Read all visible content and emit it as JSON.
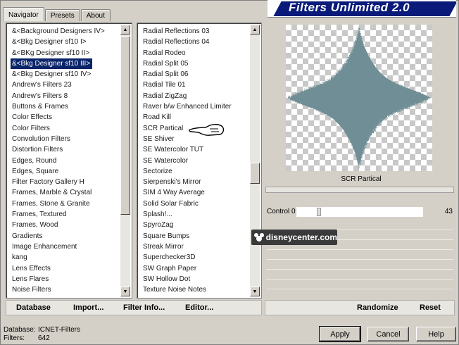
{
  "tabs": [
    "Navigator",
    "Presets",
    "About"
  ],
  "banner": {
    "title": "Filters Unlimited 2.0"
  },
  "categories": {
    "items": [
      "&<Background Designers IV>",
      "&<Bkg Designer sf10 I>",
      "&<BKg Designer sf10 II>",
      "&<Bkg Designer sf10 III>",
      "&<Bkg Designer sf10 IV>",
      "Andrew's Filters 23",
      "Andrew's Filters 8",
      "Buttons & Frames",
      "Color Effects",
      "Color Filters",
      "Convolution Filters",
      "Distortion Filters",
      "Edges, Round",
      "Edges, Square",
      "Filter Factory Gallery H",
      "Frames, Marble & Crystal",
      "Frames, Stone & Granite",
      "Frames, Textured",
      "Frames, Wood",
      "Gradients",
      "Image Enhancement",
      "kang",
      "Lens Effects",
      "Lens Flares",
      "Noise Filters"
    ],
    "selected_index": 3
  },
  "filters": {
    "items": [
      "Radial Reflections 03",
      "Radial Reflections 04",
      "Radial Rodeo",
      "Radial Split 05",
      "Radial Split 06",
      "Radial Tile 01",
      "Radial ZigZag",
      "Raver b/w Enhanced Limiter",
      "Road Kill",
      "SCR  Partical",
      "SE Shiver",
      "SE Watercolor TUT",
      "SE Watercolor",
      "Sectorize",
      "Sierpenski's Mirror",
      "SIM 4 Way Average",
      "Solid Solar Fabric",
      "Splash!...",
      "SpyroZag",
      "Square Bumps",
      "Streak Mirror",
      "Superchecker3D",
      "SW Graph Paper",
      "SW Hollow Dot",
      "Texture Noise Notes"
    ]
  },
  "preview": {
    "filter_name": "SCR  Partical",
    "shape_color": "#6f8e95"
  },
  "control": {
    "label": "Control 0:",
    "value": "43",
    "level": 43,
    "max": 255
  },
  "buttons_left": {
    "database": "Database",
    "import": "Import...",
    "filter_info": "Filter Info...",
    "editor": "Editor..."
  },
  "buttons_right": {
    "randomize": "Randomize",
    "reset": "Reset"
  },
  "status": {
    "database_label": "Database:",
    "database_value": "ICNET-Filters",
    "filters_label": "Filters:",
    "filters_value": "642"
  },
  "dialog_buttons": {
    "apply": "Apply",
    "cancel": "Cancel",
    "help": "Help"
  },
  "watermark": {
    "text": "disneycenter.com"
  },
  "colors": {
    "selection": "#0a246a",
    "banner": "#0a1a7a",
    "face": "#d4d0c8"
  }
}
